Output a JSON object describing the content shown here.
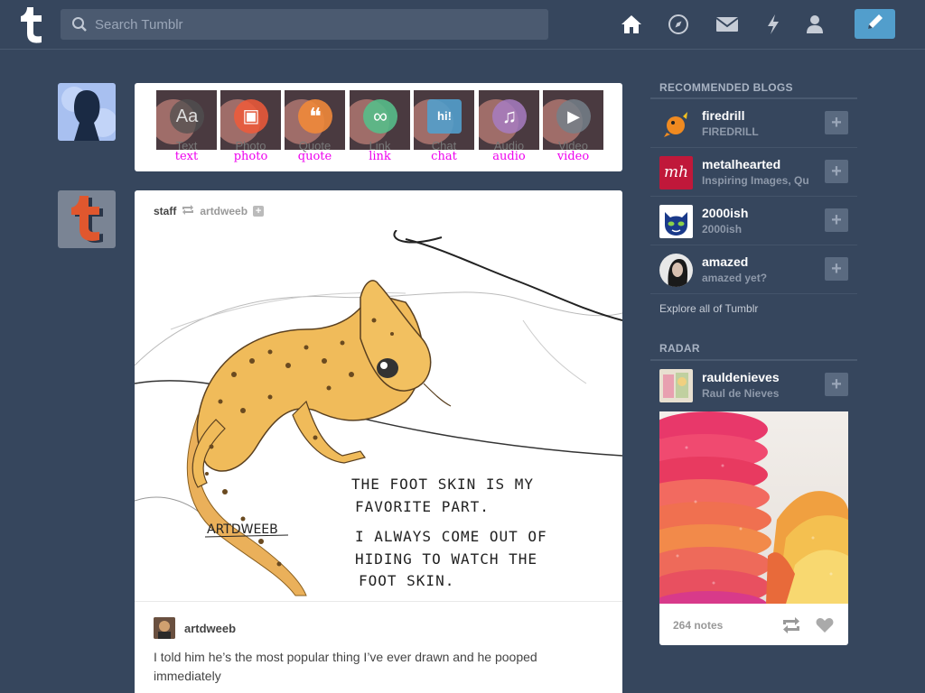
{
  "header": {
    "search_placeholder": "Search Tumblr",
    "icons": [
      "tumblr-logo-icon",
      "home-icon",
      "explore-compass-icon",
      "inbox-mail-icon",
      "activity-bolt-icon",
      "account-person-icon",
      "compose-pencil-icon"
    ]
  },
  "post_types": [
    {
      "ghost": "Text",
      "label": "text",
      "color": "#444444",
      "glyph": "Aa"
    },
    {
      "ghost": "Photo",
      "label": "photo",
      "color": "#f05a3a",
      "glyph": "▣"
    },
    {
      "ghost": "Quote",
      "label": "quote",
      "color": "#f0883a",
      "glyph": "❝"
    },
    {
      "ghost": "Link",
      "label": "link",
      "color": "#56bc8a",
      "glyph": "∞"
    },
    {
      "ghost": "Chat",
      "label": "chat",
      "color": "#529ecc",
      "glyph": "hi!"
    },
    {
      "ghost": "Audio",
      "label": "audio",
      "color": "#a77dc2",
      "glyph": "♫"
    },
    {
      "ghost": "Video",
      "label": "video",
      "color": "#748089",
      "glyph": "▶"
    }
  ],
  "post": {
    "author": "staff",
    "reblogged_from": "artdweeb",
    "follow_glyph": "+",
    "image_text": {
      "signature": "ARTDWEEB",
      "line1": "THE FOOT SKIN IS MY",
      "line2": "FAVORITE PART.",
      "line3": "I ALWAYS COME OUT OF",
      "line4": "HIDING TO WATCH THE",
      "line5": "FOOT SKIN."
    },
    "source_name": "artdweeb",
    "caption": "I told him he’s the most popular thing I’ve ever drawn and he pooped immediately"
  },
  "sidebar": {
    "recommended_title": "RECOMMENDED BLOGS",
    "blogs": [
      {
        "name": "firedrill",
        "subtitle": "FIREDRILL",
        "plus": "+"
      },
      {
        "name": "metalhearted",
        "subtitle": "Inspiring Images, Qu",
        "plus": "+",
        "avatar_text": "mh"
      },
      {
        "name": "2000ish",
        "subtitle": "2000ish",
        "plus": "+"
      },
      {
        "name": "amazed",
        "subtitle": "amazed yet?",
        "plus": "+"
      }
    ],
    "explore_link": "Explore all of Tumblr",
    "radar_title": "RADAR",
    "radar": {
      "name": "rauldenieves",
      "subtitle": "Raul de Nieves",
      "plus": "+",
      "notes": "264 notes"
    }
  },
  "colors": {
    "background": "#36465d",
    "accent_blue": "#529ecc",
    "label_magenta": "#ee00ee"
  }
}
